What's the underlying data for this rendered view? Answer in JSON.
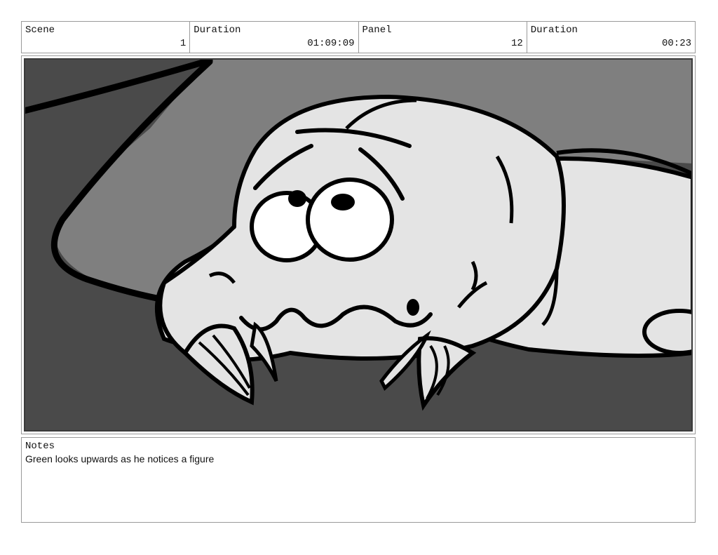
{
  "header": {
    "scene_label": "Scene",
    "scene_value": "1",
    "duration_label": "Duration",
    "duration_value": "01:09:09",
    "panel_label": "Panel",
    "panel_value": "12",
    "panel_duration_label": "Duration",
    "panel_duration_value": "00:23"
  },
  "notes": {
    "label": "Notes",
    "text": "Green looks upwards as he notices a figure"
  },
  "colors": {
    "background_dark": "#4a4a4a",
    "background_mid": "#7f7f7f",
    "creature_fill": "#e4e4e4",
    "ink": "#000000"
  }
}
